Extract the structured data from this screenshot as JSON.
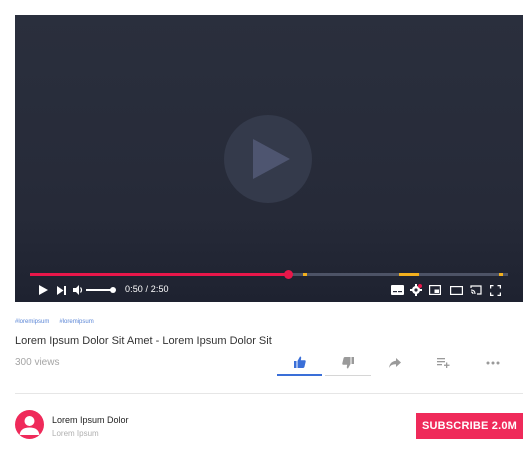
{
  "player": {
    "current_time": "0:50",
    "duration": "2:50",
    "time_separator": " / ",
    "progress_fraction": 0.54,
    "volume_fraction": 0.85,
    "colors": {
      "played": "#e8174a",
      "chapter_marker": "#f2b01e",
      "track": "#4d5366"
    }
  },
  "video": {
    "tags": [
      "#loremipsum",
      "#loremipsum"
    ],
    "title": "Lorem Ipsum Dolor Sit Amet - Lorem Ipsum Dolor Sit",
    "views": "300 views"
  },
  "actions": {
    "like_icon": "thumbs-up-icon",
    "dislike_icon": "thumbs-down-icon",
    "share_icon": "share-icon",
    "save_icon": "add-to-playlist-icon",
    "more_icon": "more-icon"
  },
  "channel": {
    "name": "Lorem Ipsum Dolor",
    "subtitle": "Lorem Ipsum",
    "subscribe_label": "SUBSCRIBE 2.0M",
    "accent": "#ef2a5a"
  }
}
